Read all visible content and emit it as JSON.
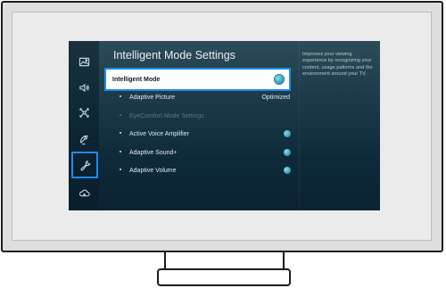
{
  "title": "Intelligent Mode Settings",
  "description": "Improves your viewing experience by recognizing your content, usage patterns and the environment around your TV.",
  "sidebar": {
    "items": [
      {
        "icon": "picture-icon"
      },
      {
        "icon": "sound-icon"
      },
      {
        "icon": "connection-icon"
      },
      {
        "icon": "broadcast-icon"
      },
      {
        "icon": "support-wrench-icon",
        "selected": true
      },
      {
        "icon": "cloud-icon"
      }
    ]
  },
  "settings": {
    "intelligent_mode": {
      "label": "Intelligent Mode",
      "state": "on"
    },
    "adaptive_picture": {
      "label": "Adaptive Picture",
      "value": "Optimized"
    },
    "eyecomfort_mode": {
      "label": "EyeComfort Mode Settings",
      "disabled": true
    },
    "active_voice_amplifier": {
      "label": "Active Voice Amplifier",
      "state": "on"
    },
    "adaptive_sound": {
      "label": "Adaptive Sound+",
      "state": "on"
    },
    "adaptive_volume": {
      "label": "Adaptive Volume",
      "state": "on"
    }
  },
  "colors": {
    "focus_blue": "#1f8bef",
    "toggle_on": "#3fa7c3",
    "screen_bg": "#0e2a3a"
  }
}
